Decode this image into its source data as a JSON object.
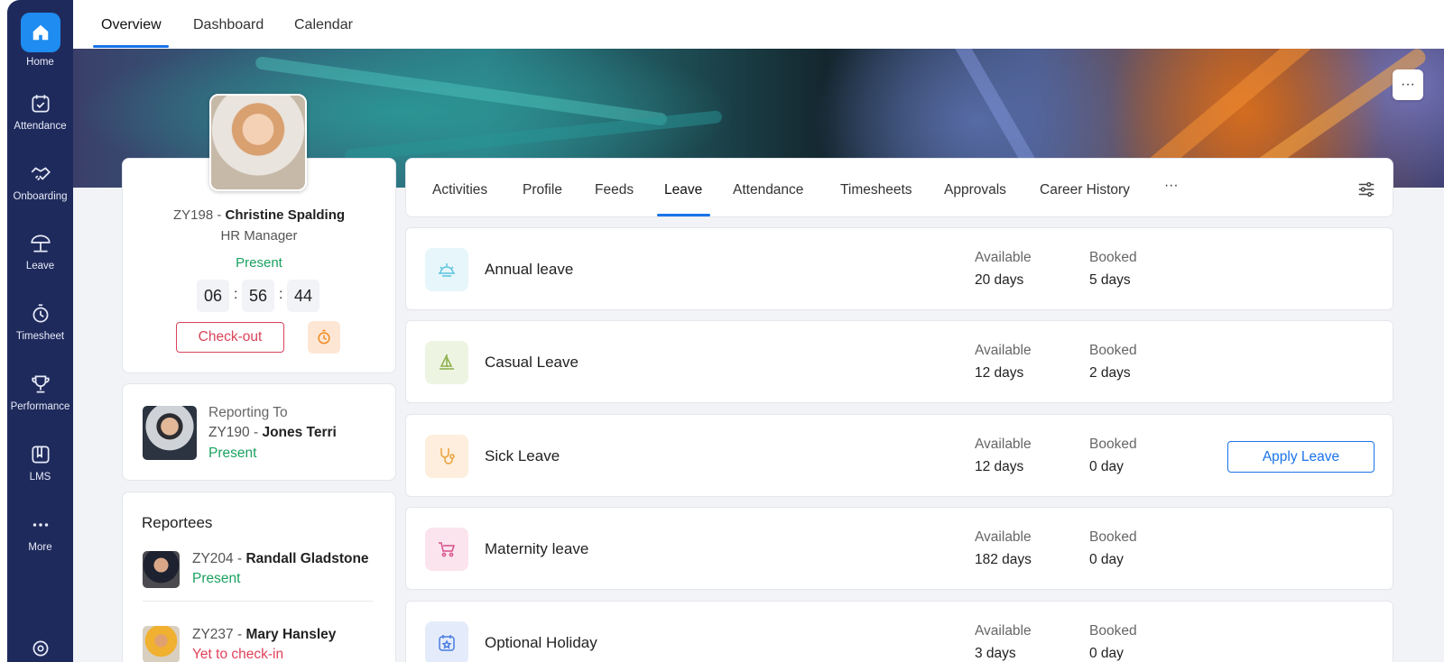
{
  "sidebar": {
    "items": [
      {
        "label": "Home",
        "icon": "home-icon"
      },
      {
        "label": "Attendance",
        "icon": "calendar-check-icon"
      },
      {
        "label": "Onboarding",
        "icon": "handshake-icon"
      },
      {
        "label": "Leave",
        "icon": "beach-umbrella-icon"
      },
      {
        "label": "Timesheet",
        "icon": "timer-icon"
      },
      {
        "label": "Performance",
        "icon": "trophy-icon"
      },
      {
        "label": "LMS",
        "icon": "book-icon"
      },
      {
        "label": "More",
        "icon": "more-dots-icon"
      }
    ]
  },
  "top_tabs": [
    "Overview",
    "Dashboard",
    "Calendar"
  ],
  "banner": {
    "more_label": "···"
  },
  "profile": {
    "emp_id": "ZY198",
    "name": "Christine Spalding",
    "role": "HR Manager",
    "status": "Present",
    "timer": {
      "h": "06",
      "m": "56",
      "s": "44"
    },
    "checkout_label": "Check-out"
  },
  "reporting": {
    "title": "Reporting To",
    "emp_id": "ZY190",
    "name": "Jones Terri",
    "status": "Present"
  },
  "reportees": {
    "title": "Reportees",
    "items": [
      {
        "emp_id": "ZY204",
        "name": "Randall Gladstone",
        "status": "Present"
      },
      {
        "emp_id": "ZY237",
        "name": "Mary Hansley",
        "status": "Yet to check-in"
      }
    ]
  },
  "sub_tabs": [
    "Activities",
    "Profile",
    "Feeds",
    "Leave",
    "Attendance",
    "Timesheets",
    "Approvals",
    "Career History"
  ],
  "sub_tabs_more": "···",
  "leave": {
    "available_label": "Available",
    "booked_label": "Booked",
    "apply_label": "Apply Leave",
    "types": [
      {
        "name": "Annual leave",
        "available": "20 days",
        "booked": "5 days",
        "icon": "sunrise-icon",
        "color": "#e6f6fb"
      },
      {
        "name": "Casual Leave",
        "available": "12 days",
        "booked": "2 days",
        "icon": "sailboat-icon",
        "color": "#eef4e2"
      },
      {
        "name": "Sick Leave",
        "available": "12 days",
        "booked": "0 day",
        "icon": "stethoscope-icon",
        "color": "#fdeedd"
      },
      {
        "name": "Maternity leave",
        "available": "182 days",
        "booked": "0 day",
        "icon": "stroller-icon",
        "color": "#fbe4ee"
      },
      {
        "name": "Optional Holiday",
        "available": "3 days",
        "booked": "0 day",
        "icon": "calendar-star-icon",
        "color": "#e4ecfb"
      }
    ]
  },
  "colors": {
    "sidebar": "#1f2a5c",
    "accent": "#1a73e8",
    "present": "#1aa160",
    "absent": "#e0405a"
  }
}
